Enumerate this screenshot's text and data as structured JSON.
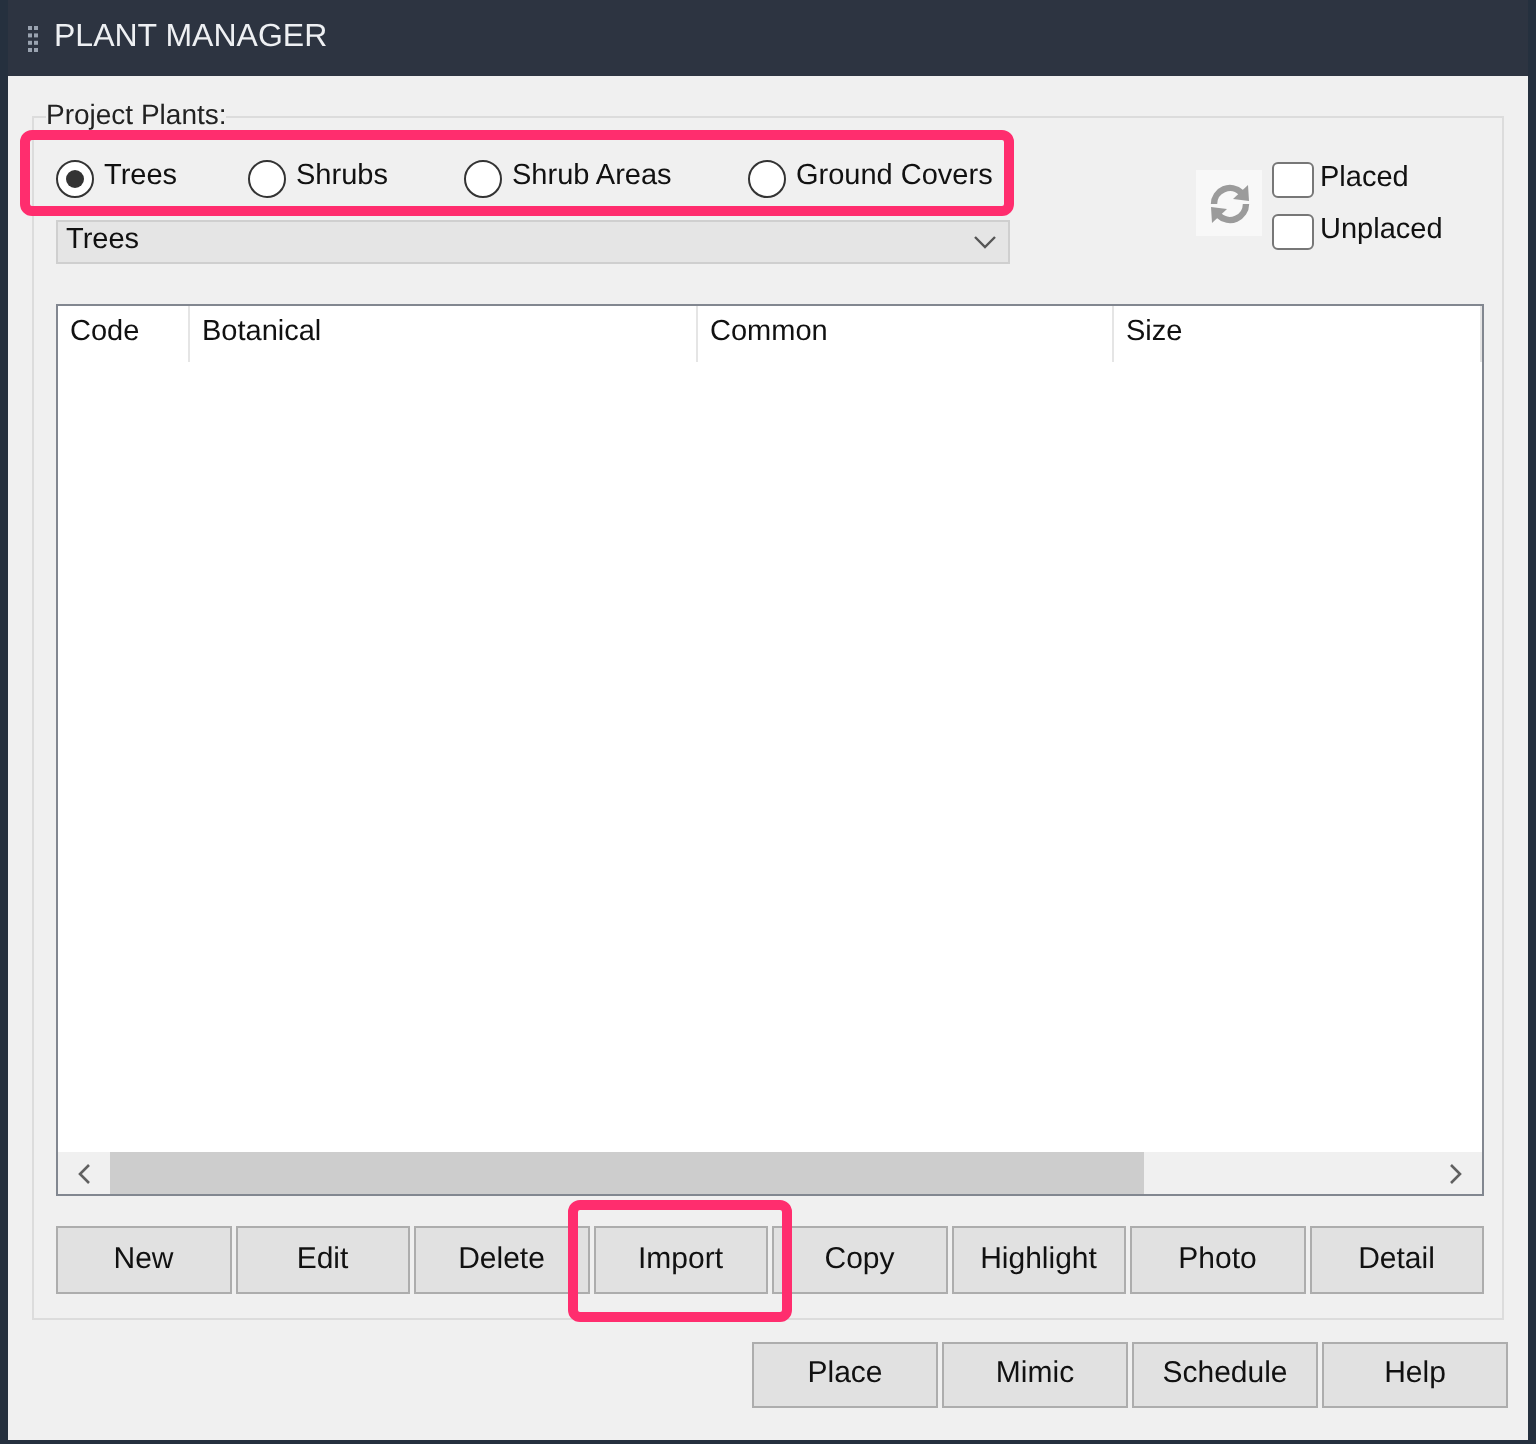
{
  "window": {
    "title": "PLANT MANAGER"
  },
  "project_plants": {
    "label": "Project Plants:",
    "highlighted": true,
    "plant_types": [
      {
        "label": "Trees",
        "selected": true
      },
      {
        "label": "Shrubs",
        "selected": false
      },
      {
        "label": "Shrub Areas",
        "selected": false
      },
      {
        "label": "Ground Covers",
        "selected": false
      }
    ],
    "dropdown": {
      "value": "Trees"
    }
  },
  "filters": [
    {
      "label": "Placed",
      "checked": false
    },
    {
      "label": "Unplaced",
      "checked": false
    }
  ],
  "table": {
    "columns": [
      "Code",
      "Botanical",
      "Common",
      "Size"
    ]
  },
  "actions": [
    {
      "label": "New",
      "highlighted": false
    },
    {
      "label": "Edit",
      "highlighted": false
    },
    {
      "label": "Delete",
      "highlighted": false
    },
    {
      "label": "Import",
      "highlighted": true
    },
    {
      "label": "Copy",
      "highlighted": false
    },
    {
      "label": "Highlight",
      "highlighted": false
    },
    {
      "label": "Photo",
      "highlighted": false
    },
    {
      "label": "Detail",
      "highlighted": false
    }
  ],
  "footer_buttons": [
    "Place",
    "Mimic",
    "Schedule",
    "Help"
  ]
}
